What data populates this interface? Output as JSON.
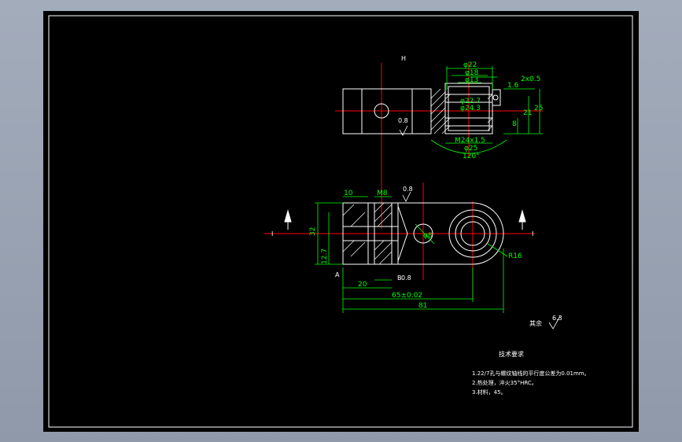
{
  "dimensions": {
    "d22": "φ22",
    "d18": "φ18",
    "d13": "φ13",
    "d22_outer": "φ22.7",
    "d24_3": "φ24.3",
    "chamfer": "2x0.5",
    "surface_top": "1.6",
    "v25": "25",
    "v21": "21",
    "v8": "8",
    "thread": "M24x1.5",
    "d25": "φ25",
    "angle": "120°",
    "d10": "10",
    "m8": "M8",
    "v32": "32",
    "v12_7": "12.7",
    "v20": "20",
    "v65": "65±0.02",
    "v81": "81",
    "r16": "R16",
    "d8": "φ8"
  },
  "section_labels": {
    "top_view": "H",
    "left": "I",
    "right": "I",
    "A": "A",
    "B": "B"
  },
  "roughness": {
    "r08a": "0.8",
    "r08b": "0.8",
    "r08c": "0.8",
    "rest_label": "其余",
    "rest_value": "6.3"
  },
  "notes": {
    "title": "技术要求",
    "line1": "1.22/7孔与螺纹轴线的平行度公差为0.01mm。",
    "line2": "2.热处理，淬火35°HRC。",
    "line3": "3.材料，45。"
  },
  "colors": {
    "outline": "#ffffff",
    "dimension": "#00ff00",
    "centerline": "#ff0000",
    "hatch": "#ffffff"
  }
}
